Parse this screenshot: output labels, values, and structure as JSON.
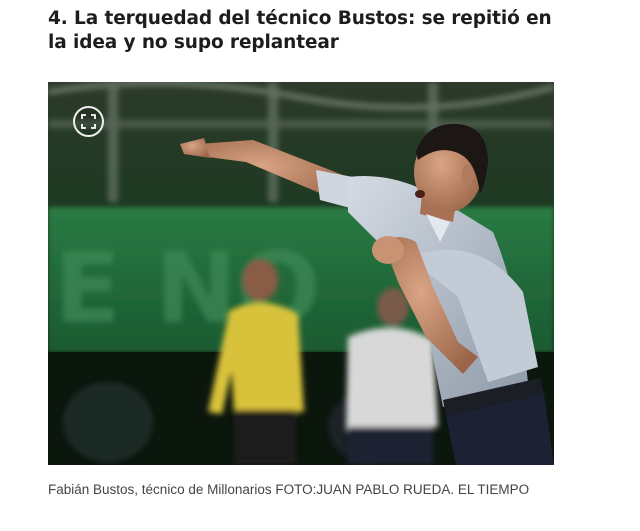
{
  "article": {
    "heading": "4. La terquedad del técnico Bustos: se repitió en la idea y no supo replantear",
    "caption": "Fabián Bustos, técnico de Millonarios FOTO:JUAN PABLO RUEDA. EL TIEMPO"
  },
  "image": {
    "expand_icon": "fullscreen-expand-icon",
    "stadium_banner_text": "E NO"
  },
  "colors": {
    "heading": "#1d1d1d",
    "caption": "#444444",
    "pitch_green": "#1f6e3a",
    "shirt": "#b9c2cf"
  }
}
